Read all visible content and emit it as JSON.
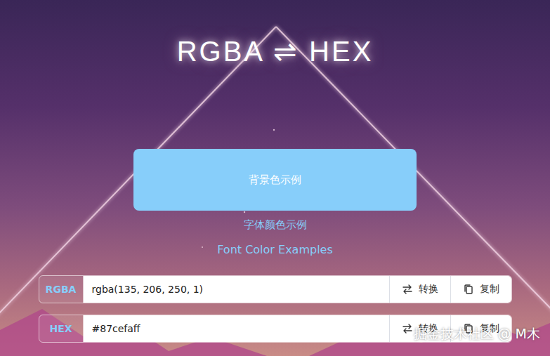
{
  "title": "RGBA ⇌ HEX",
  "sample": {
    "color": "#87cefa",
    "background_text": "背景色示例",
    "font_text_zh": "字体颜色示例",
    "font_text_en": "Font Color Examples"
  },
  "rows": [
    {
      "label": "RGBA",
      "value": "rgba(135, 206, 250, 1)",
      "buttons": [
        {
          "label": "转换",
          "icon": "swap"
        },
        {
          "label": "复制",
          "icon": "copy"
        }
      ]
    },
    {
      "label": "HEX",
      "value": "#87cefaff",
      "buttons": [
        {
          "label": "转换",
          "icon": "swap"
        },
        {
          "label": "复制",
          "icon": "copy"
        }
      ]
    }
  ],
  "watermark": "掘金技术社区 @ M木"
}
